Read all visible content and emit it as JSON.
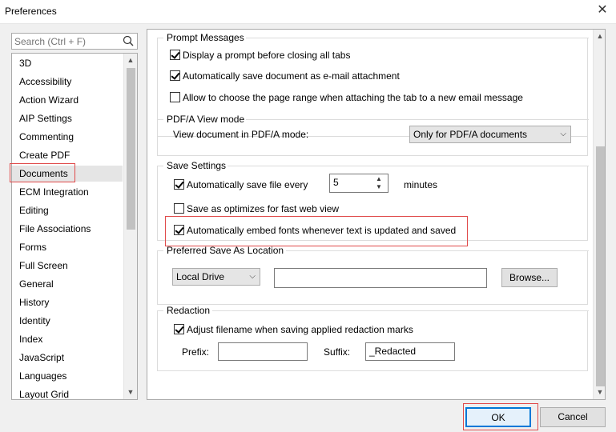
{
  "window": {
    "title": "Preferences",
    "close": "✕"
  },
  "search": {
    "placeholder": "Search (Ctrl + F)"
  },
  "categories": [
    "3D",
    "Accessibility",
    "Action Wizard",
    "AIP Settings",
    "Commenting",
    "Create PDF",
    "Documents",
    "ECM Integration",
    "Editing",
    "File Associations",
    "Forms",
    "Full Screen",
    "General",
    "History",
    "Identity",
    "Index",
    "JavaScript",
    "Languages",
    "Layout Grid"
  ],
  "selected_category": "Documents",
  "prompt_messages": {
    "title": "Prompt Messages",
    "opt1": {
      "label": "Display a prompt before closing all tabs",
      "checked": true
    },
    "opt2": {
      "label": "Automatically save document as e-mail attachment",
      "checked": true
    },
    "opt3": {
      "label": "Allow to choose the page range when attaching the tab to a new email message",
      "checked": false
    }
  },
  "pdfa": {
    "title": "PDF/A View mode",
    "label": "View document in PDF/A mode:",
    "value": "Only for PDF/A documents"
  },
  "save_settings": {
    "title": "Save Settings",
    "autosave": {
      "label": "Automatically save file every",
      "checked": true,
      "value": "5",
      "unit": "minutes"
    },
    "optimize": {
      "label": "Save as optimizes for fast web view",
      "checked": false
    },
    "embed": {
      "label": "Automatically embed fonts whenever text is updated and saved",
      "checked": true
    }
  },
  "save_location": {
    "title": "Preferred Save As Location",
    "dropdown": "Local Drive",
    "path": "",
    "browse": "Browse..."
  },
  "redaction": {
    "title": "Redaction",
    "adjust": {
      "label": "Adjust filename when saving applied redaction marks",
      "checked": true
    },
    "prefix_label": "Prefix:",
    "prefix_value": "",
    "suffix_label": "Suffix:",
    "suffix_value": "_Redacted"
  },
  "footer": {
    "ok": "OK",
    "cancel": "Cancel"
  },
  "colors": {
    "highlight": "#e04a4a",
    "selected_bg": "#e5e5e5",
    "ok_border": "#0078d7"
  }
}
